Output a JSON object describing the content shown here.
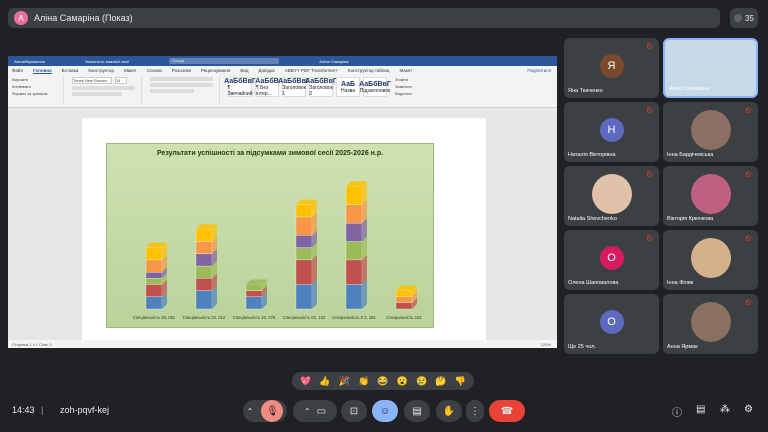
{
  "top": {
    "presenter": "Аліна Самаріна (Показ)",
    "avatar_letter": "А",
    "participants_count": "35"
  },
  "word": {
    "title_left": "Автозбереження",
    "doc_name": "Успішність зимової сесії",
    "search": "Пошук",
    "user": "Аліна Самаріна",
    "menu": [
      "Файл",
      "Головна",
      "Вставка",
      "Конструктор",
      "Макет",
      "Ссилки",
      "Розсилки",
      "Рецензування",
      "Вид",
      "Довідка",
      "ABBYY PDF Transformer+",
      "Конструктор таблиц",
      "Макет"
    ],
    "active_menu": "Головна",
    "share_label": "Поділитися",
    "font": "Times New Roman",
    "font_size": "14",
    "styles": [
      {
        "sample": "АаБбВвГ",
        "name": "¶ Звичайний"
      },
      {
        "sample": "АаБбВ",
        "name": "¶ Без інтер..."
      },
      {
        "sample": "АаБбВвГ",
        "name": "Заголовок 1"
      },
      {
        "sample": "АаБбВвГ",
        "name": "Заголовок 2"
      },
      {
        "sample": "АаБ",
        "name": "Назва"
      },
      {
        "sample": "АаБбВвГ",
        "name": "Підзаголовок"
      }
    ],
    "clipboard_items": [
      "Вирізати",
      "Копіювати",
      "Формат за зразком"
    ],
    "edit_items": [
      "Знайти",
      "Замінити",
      "Виділити"
    ],
    "status": "Сторінка 1 з 1   Слів: 0",
    "zoom": "120%"
  },
  "chart_data": {
    "type": "bar",
    "title": "Результати успішності за підсумками зимової сесії 2025-2026 н.р.",
    "categories": [
      "Спеціальність 26, 051",
      "Спеціальність 02, 012",
      "Спеціальність 20, 076",
      "Спеціальність 02, 122",
      "Спеціальність 0 3, 181",
      "Спеціальність 101"
    ],
    "series": [
      {
        "name": "",
        "color": "#4f81bd",
        "values": [
          2,
          3,
          2,
          4,
          4,
          0
        ]
      },
      {
        "name": "",
        "color": "#c0504d",
        "values": [
          2,
          2,
          1,
          4,
          4,
          1
        ]
      },
      {
        "name": "",
        "color": "#9bbb59",
        "values": [
          1,
          2,
          1,
          2,
          3,
          0
        ]
      },
      {
        "name": "",
        "color": "#8064a2",
        "values": [
          1,
          2,
          0,
          2,
          3,
          0
        ]
      },
      {
        "name": "",
        "color": "#f79646",
        "values": [
          2,
          2,
          0,
          3,
          3,
          1
        ]
      },
      {
        "name": "",
        "color": "#ffc000",
        "values": [
          2,
          2,
          0,
          2,
          3,
          1
        ]
      }
    ],
    "ylim": [
      0,
      22
    ],
    "grid": false,
    "legend": "none"
  },
  "participants": [
    {
      "name": "Яна Ткаченко",
      "letter": "Я",
      "color": "#7a4a2c",
      "muted": true
    },
    {
      "name": "Аліна Самаріна",
      "letter": "",
      "color": "#c7d8e8",
      "muted": false,
      "speaking": true
    },
    {
      "name": "Наталія Вікторівна",
      "letter": "Н",
      "color": "#5c6bc0",
      "muted": true
    },
    {
      "name": "Інна Бардічевська",
      "letter": "",
      "color": "#8d6e63",
      "muted": true
    },
    {
      "name": "Natalia Shevchenko",
      "letter": "",
      "color": "#e0c2a8",
      "muted": true
    },
    {
      "name": "Вікторія Крючкова",
      "letter": "",
      "color": "#c06080",
      "muted": true
    },
    {
      "name": "Олена Шаповалова",
      "letter": "О",
      "color": "#d81b60",
      "muted": true
    },
    {
      "name": "Інна Філик",
      "letter": "",
      "color": "#d4b08c",
      "muted": true
    },
    {
      "name": "Ще 25 чол.",
      "letter": "О",
      "color": "#5c6bc0",
      "muted": false
    },
    {
      "name": "Анна Ярмак",
      "letter": "",
      "color": "#8a7060",
      "muted": true
    }
  ],
  "reactions": [
    "💖",
    "👍",
    "🎉",
    "👏",
    "😂",
    "😮",
    "😢",
    "🤔",
    "👎"
  ],
  "bottom": {
    "time": "14:43",
    "separator": "|",
    "code": "zoh-pqvf-kej"
  }
}
